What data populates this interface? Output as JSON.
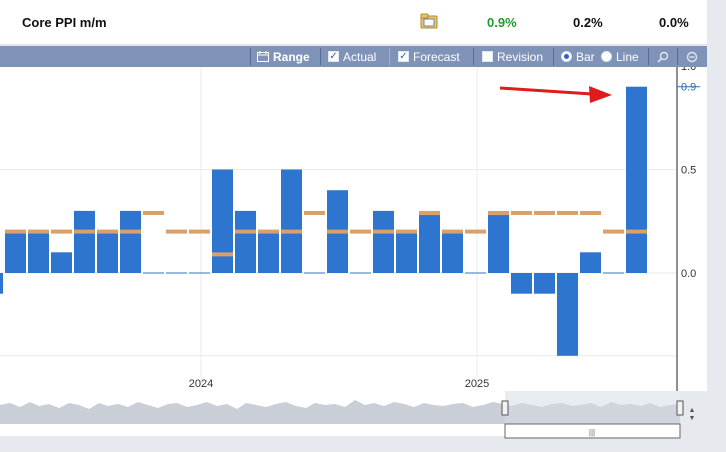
{
  "header": {
    "title": "Core PPI m/m",
    "actual": "0.9%",
    "forecast": "0.2%",
    "previous": "0.0%",
    "actual_color": "#1e9a2f"
  },
  "toolbar": {
    "range_label": "Range",
    "actual_label": "Actual",
    "forecast_label": "Forecast",
    "revision_label": "Revision",
    "bar_label": "Bar",
    "line_label": "Line",
    "actual_checked": true,
    "forecast_checked": true,
    "revision_checked": false,
    "chart_mode": "Bar"
  },
  "chart_data": {
    "type": "bar",
    "x_labels": [
      "2024",
      "2025"
    ],
    "y_ticks": [
      "1.0",
      "0.9",
      "0.5",
      "0.0"
    ],
    "actual_values": [
      -0.1,
      0.2,
      0.2,
      0.1,
      0.3,
      0.2,
      0.3,
      0.0,
      0.0,
      0.0,
      0.5,
      0.3,
      0.2,
      0.5,
      0.0,
      0.4,
      0.0,
      0.3,
      0.2,
      0.28,
      0.2,
      0.0,
      0.28,
      -0.1,
      -0.1,
      -0.4,
      0.1,
      0.0,
      0.9
    ],
    "forecast_values": [
      null,
      0.2,
      0.2,
      0.2,
      0.2,
      0.2,
      0.2,
      0.29,
      0.2,
      0.2,
      0.09,
      0.2,
      0.2,
      0.2,
      0.29,
      0.2,
      0.2,
      0.2,
      0.2,
      0.29,
      0.2,
      0.2,
      0.29,
      0.29,
      0.29,
      0.29,
      0.29,
      0.2,
      0.2
    ],
    "colors": {
      "actual": "#2e75d0",
      "forecast": "#d9a06a",
      "annotation_arrow": "#e01b1b"
    }
  },
  "icons": {
    "folder": "folder-icon",
    "range": "calendar-icon",
    "zoom_in": "zoom-in-icon",
    "zoom_out": "zoom-out-icon"
  }
}
